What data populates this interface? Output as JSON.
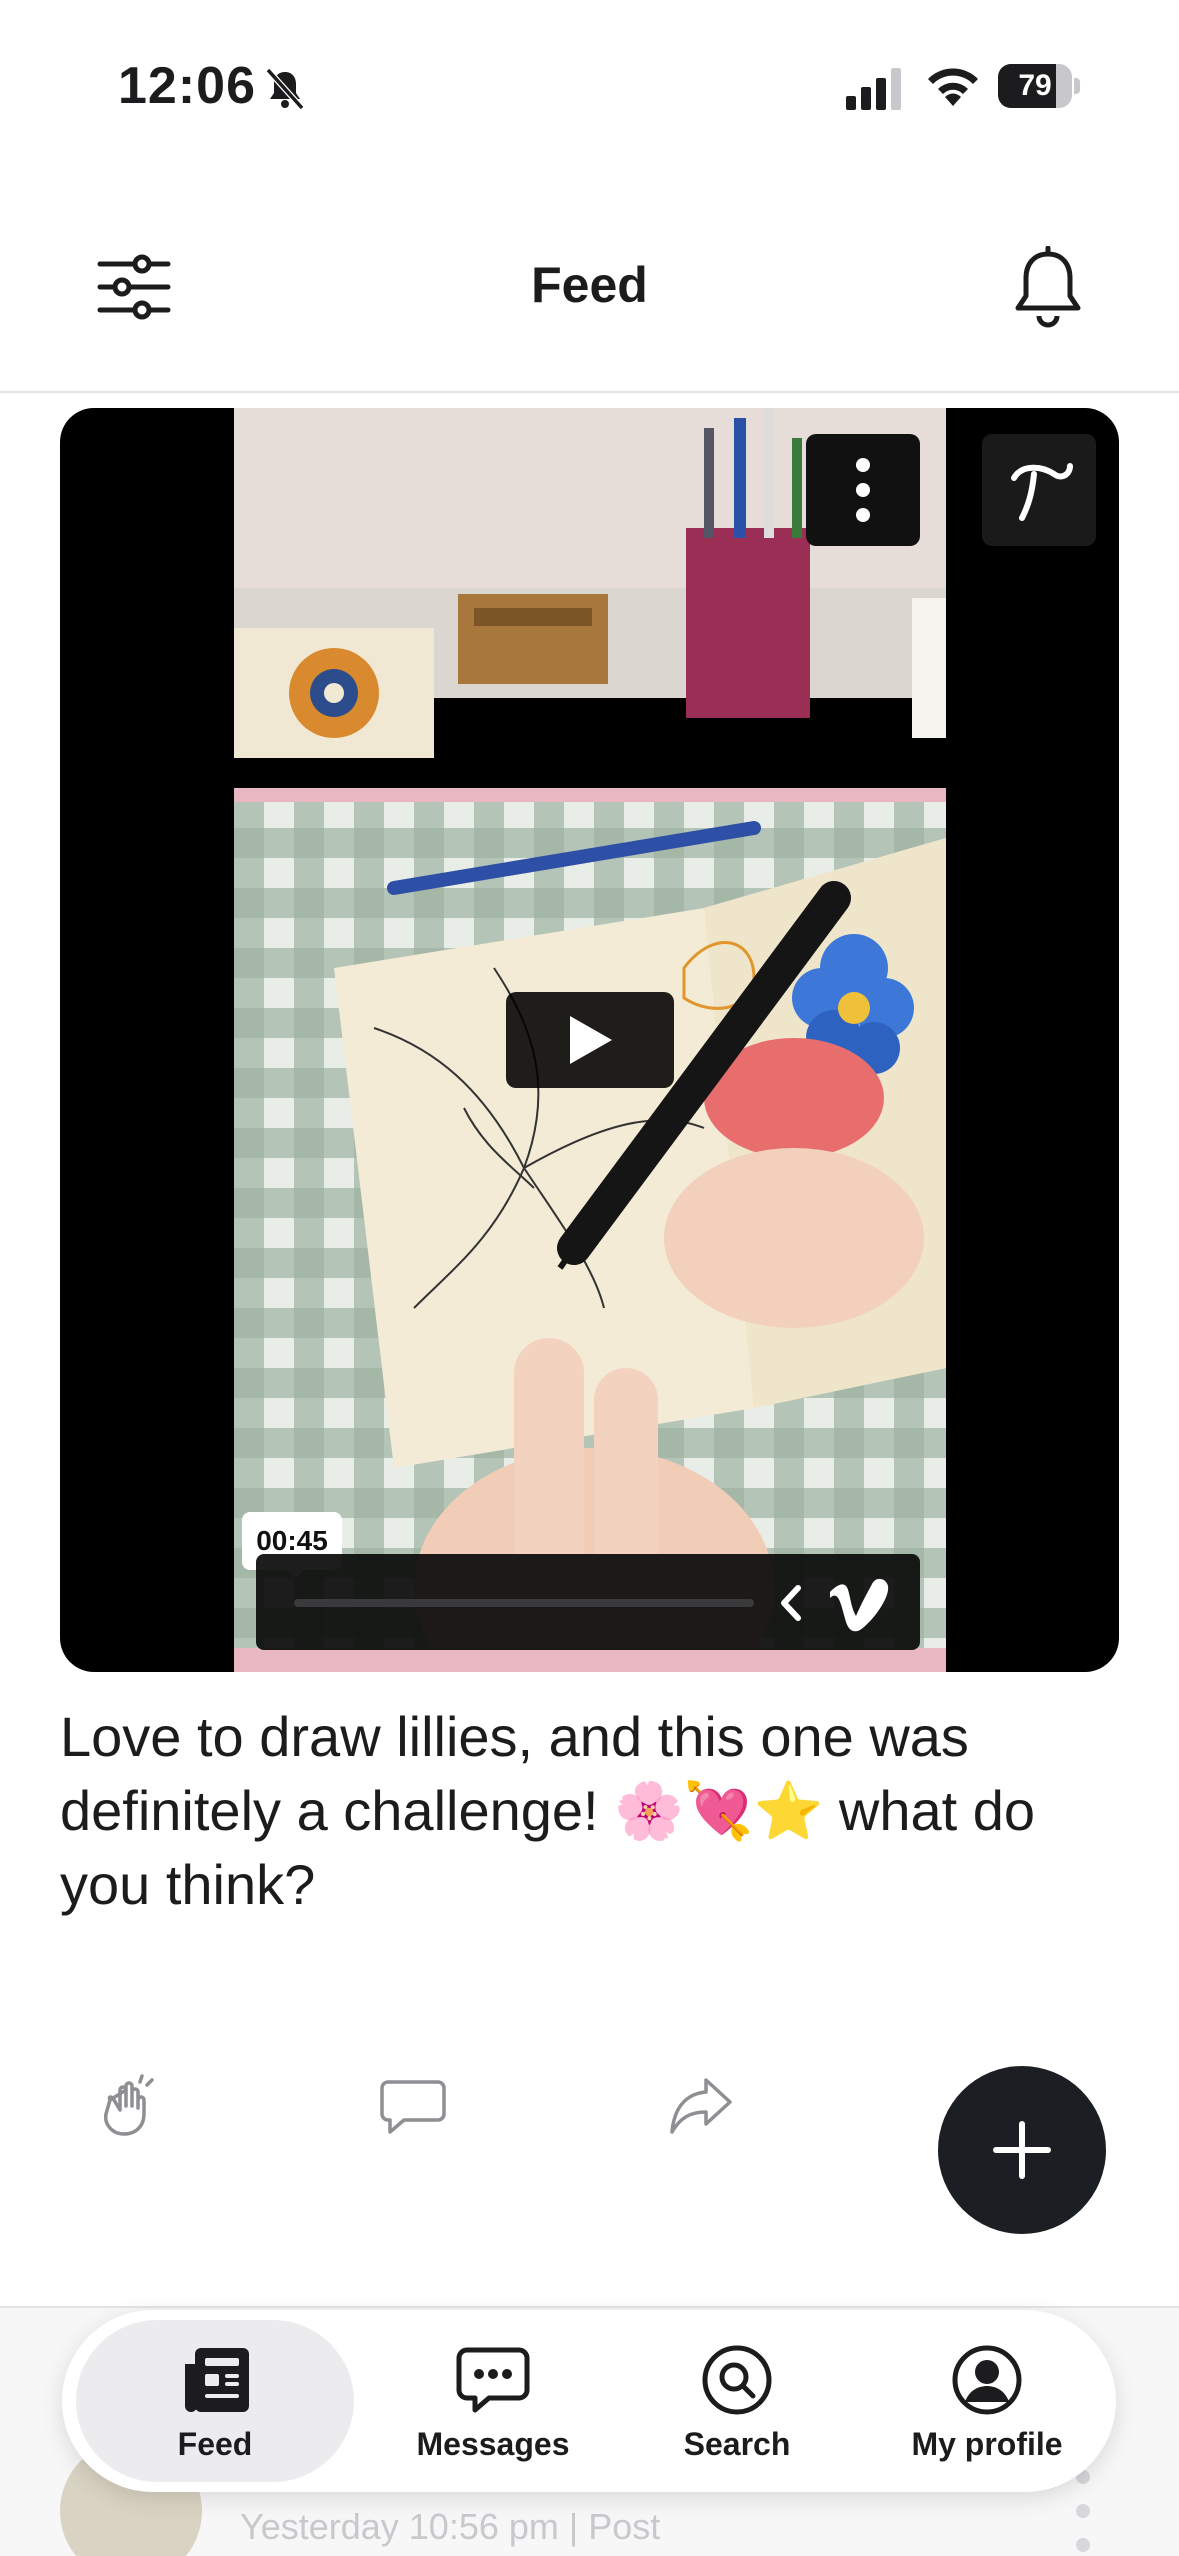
{
  "status_bar": {
    "time": "12:06",
    "battery_level": "79",
    "battery_fraction": 0.79,
    "icons": [
      "bell-slash-icon",
      "cellular-signal-icon",
      "wifi-icon",
      "battery-icon"
    ]
  },
  "header": {
    "title": "Feed",
    "left_icon": "filter-sliders-icon",
    "right_icon": "bell-icon"
  },
  "post": {
    "video": {
      "duration_label": "00:45",
      "progress_fraction": 0.0,
      "provider_icon": "vimeo-logo-icon",
      "overlay_icons": [
        "more-vertical-icon",
        "brand-logo-icon",
        "play-icon",
        "chevron-left-icon"
      ]
    },
    "caption": "Love to draw lillies, and this one was definitely a challenge! 🌸💘⭐ what do you think?",
    "actions": [
      "clap-icon",
      "comment-icon",
      "share-icon"
    ],
    "fab_icon": "plus-icon"
  },
  "next_post": {
    "meta": "Yesterday 10:56 pm | Post"
  },
  "tab_bar": {
    "active": "Feed",
    "tabs": [
      {
        "label": "Feed",
        "icon": "newspaper-icon"
      },
      {
        "label": "Messages",
        "icon": "chat-bubble-icon"
      },
      {
        "label": "Search",
        "icon": "search-icon"
      },
      {
        "label": "My profile",
        "icon": "user-circle-icon"
      }
    ]
  },
  "colors": {
    "text": "#1c1c1e",
    "fab": "#1b1f23",
    "tab_active_bg": "#ececef",
    "icon_grey": "#8e8e93"
  }
}
